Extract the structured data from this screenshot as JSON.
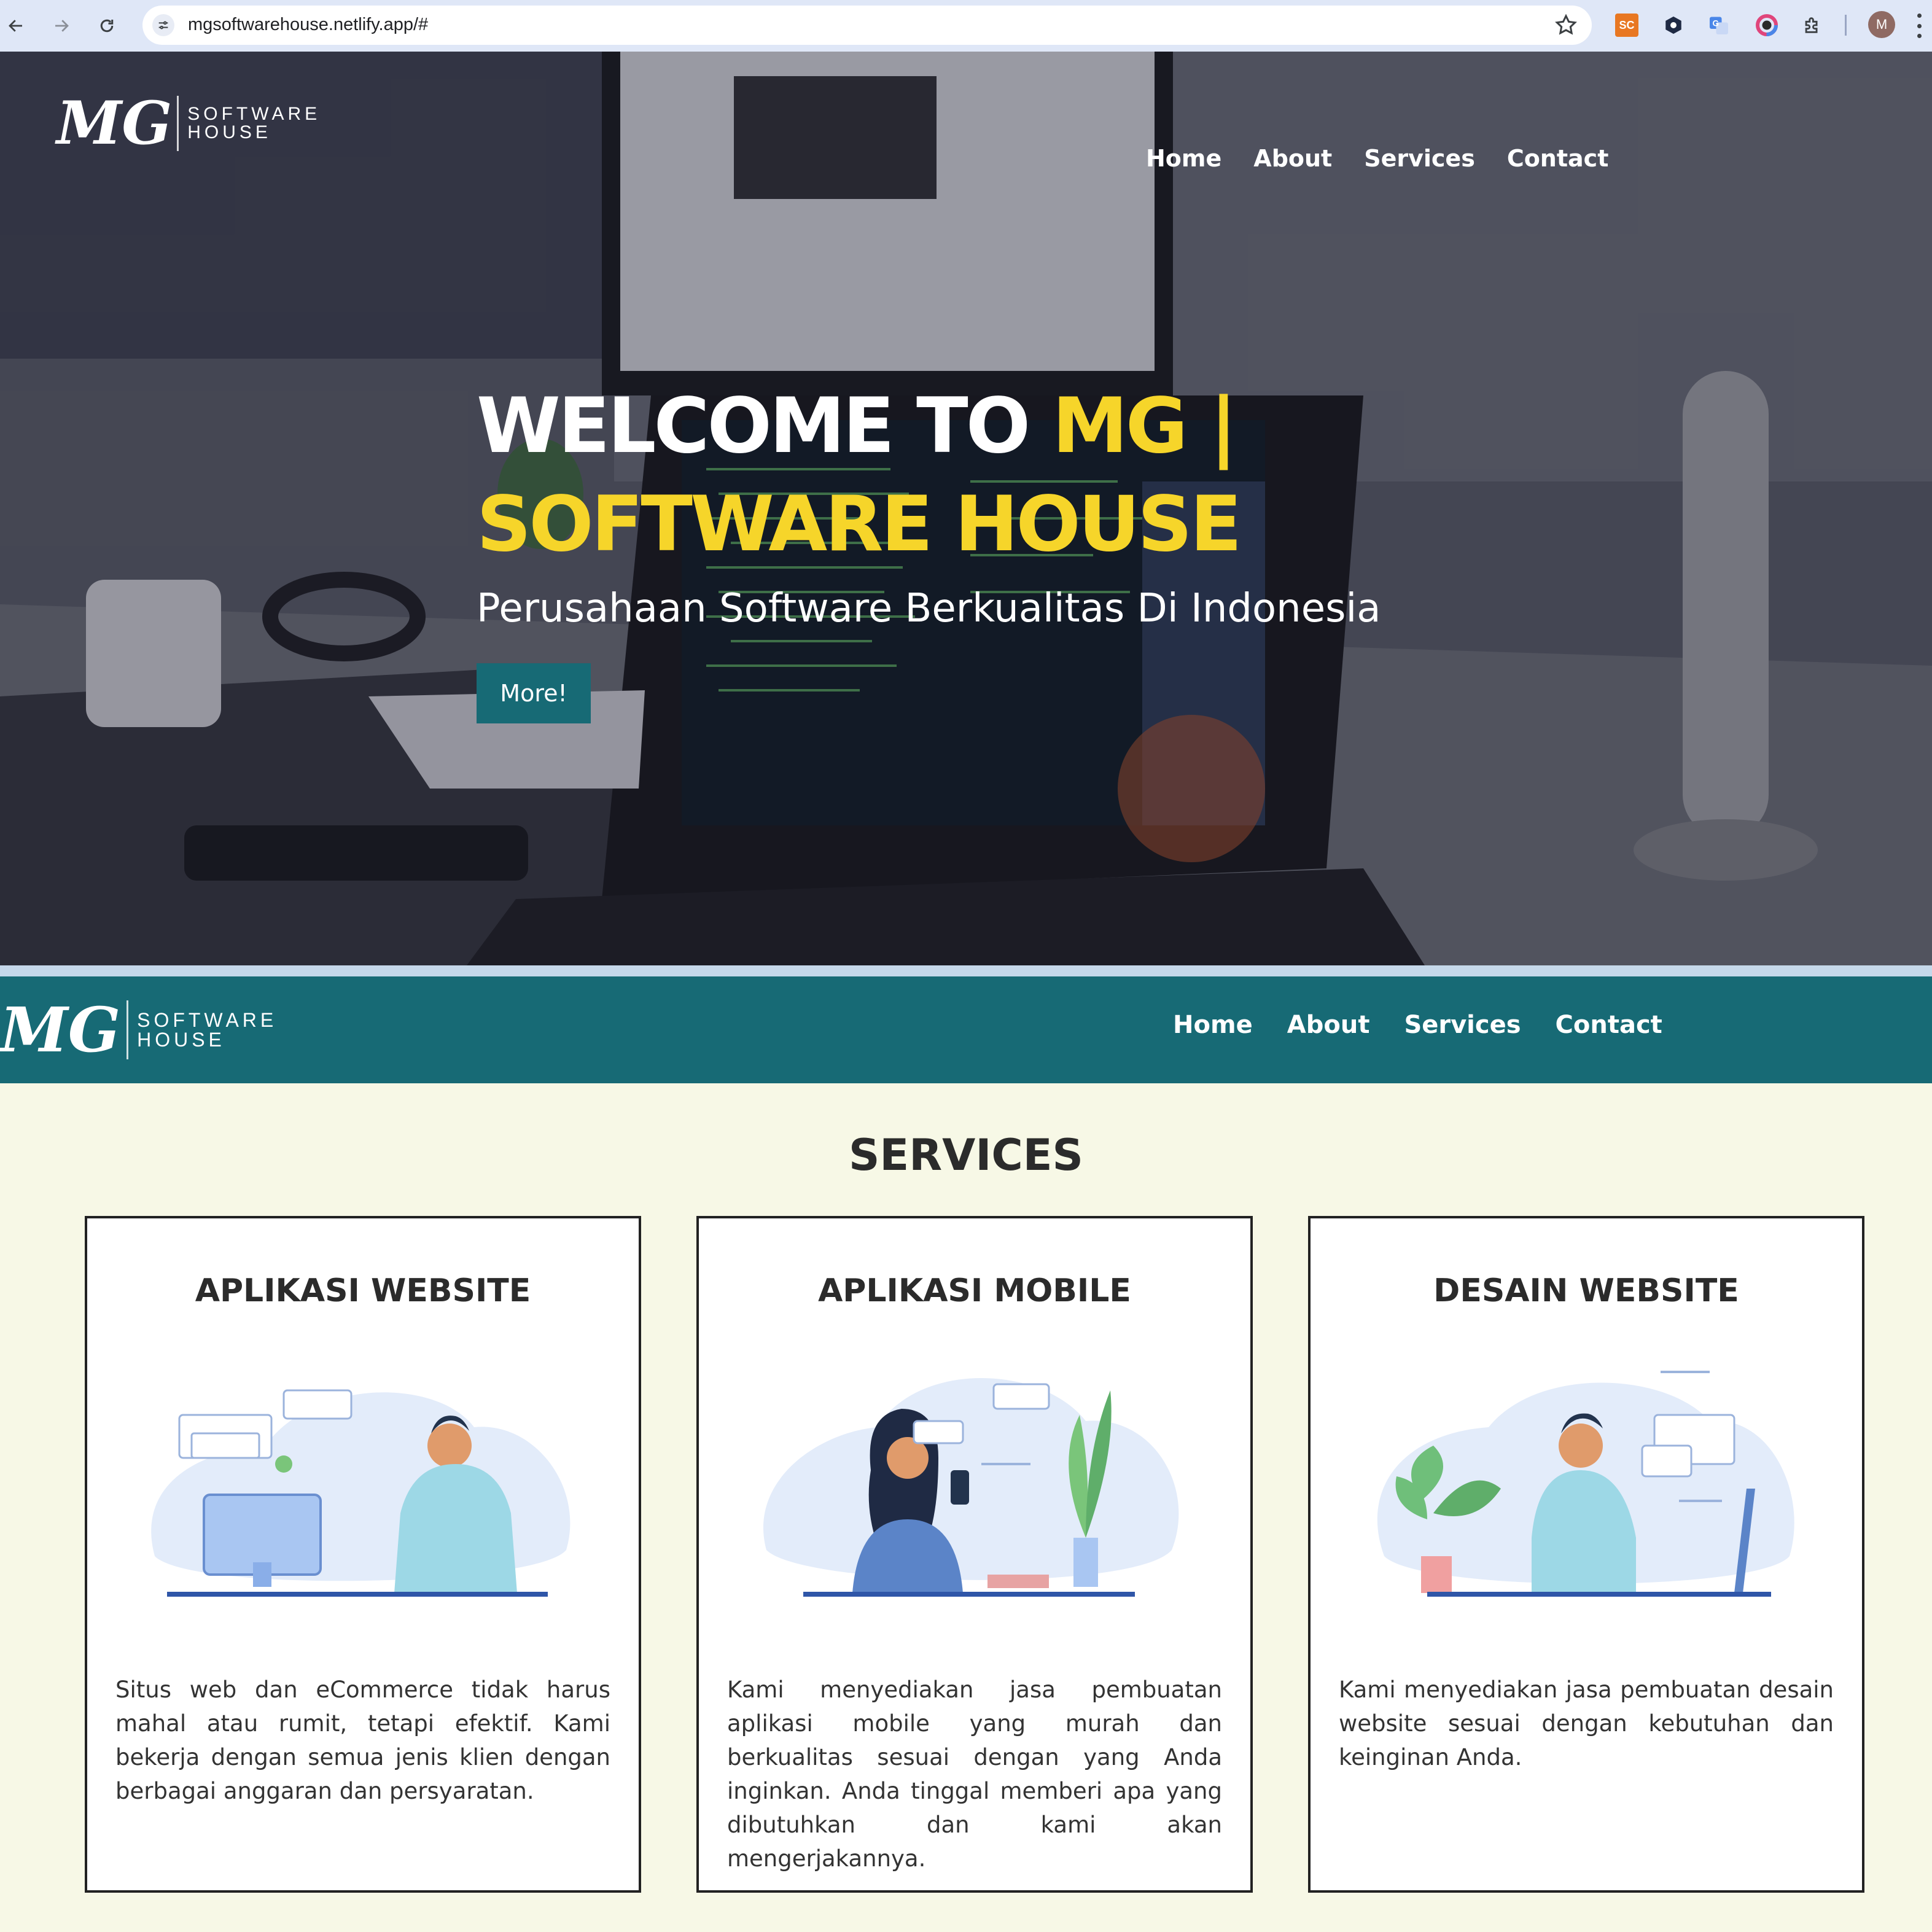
{
  "browser": {
    "url": "mgsoftwarehouse.netlify.app/#",
    "extensions": [
      {
        "name": "sc-extension-icon",
        "label": "SC"
      },
      {
        "name": "hexagon-extension-icon"
      },
      {
        "name": "translate-extension-icon"
      },
      {
        "name": "color-ring-extension-icon"
      },
      {
        "name": "puzzle-extensions-icon"
      }
    ],
    "profile_initial": "M"
  },
  "brand": {
    "mark": "MG",
    "line1": "SOFTWARE",
    "line2": "HOUSE"
  },
  "nav": {
    "items": [
      "Home",
      "About",
      "Services",
      "Contact"
    ]
  },
  "hero": {
    "title_white": "WELCOME TO ",
    "title_accent_1": "MG |",
    "title_accent_2": "SOFTWARE HOUSE",
    "subtitle": "Perusahaan Software Berkualitas Di Indonesia",
    "button": "More!"
  },
  "services": {
    "heading": "SERVICES",
    "cards": [
      {
        "title": "APLIKASI WEBSITE",
        "text": "Situs web dan eCommerce tidak harus mahal atau rumit, tetapi efektif. Kami bekerja dengan semua jenis klien dengan berbagai anggaran dan persyaratan."
      },
      {
        "title": "APLIKASI MOBILE",
        "text": "Kami menyediakan jasa pembuatan aplikasi mobile yang murah dan berkualitas sesuai dengan yang Anda inginkan. Anda tinggal memberi apa yang dibutuhkan dan kami akan mengerjakannya."
      },
      {
        "title": "DESAIN WEBSITE",
        "text": "Kami menyediakan jasa pembuatan desain website sesuai dengan kebutuhan dan keinginan Anda."
      }
    ]
  },
  "colors": {
    "accent_yellow": "#f6d52a",
    "teal": "#176a75",
    "page_bg": "#f7f8e6"
  }
}
